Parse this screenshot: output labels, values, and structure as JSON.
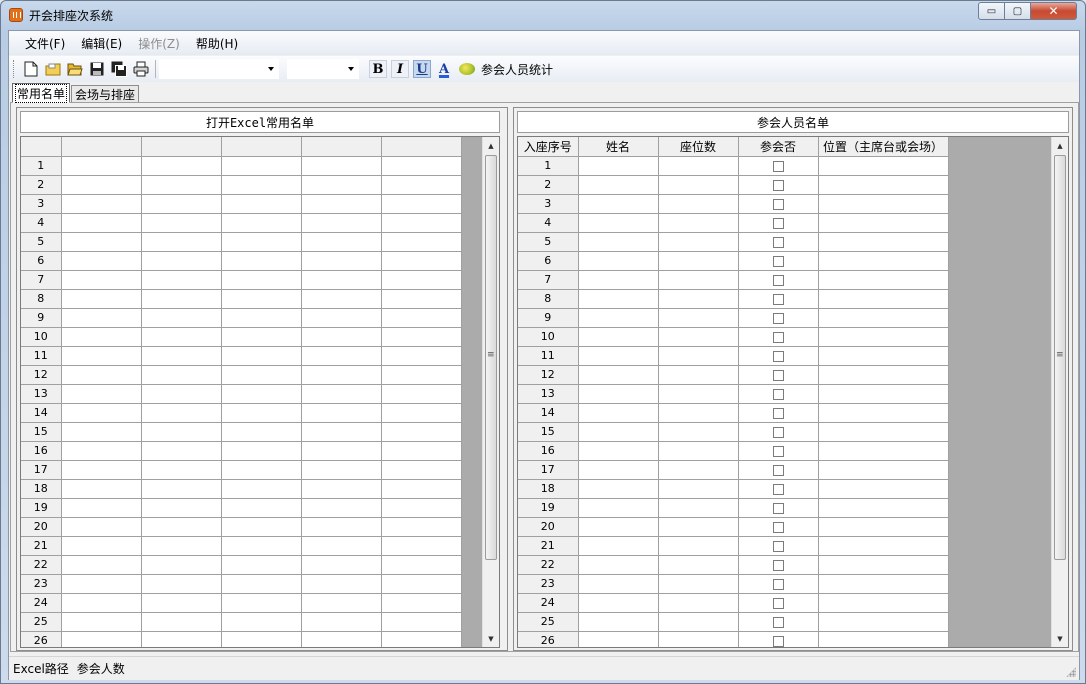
{
  "window": {
    "title": "开会排座次系统",
    "min_label": "▭",
    "max_label": "▢",
    "close_label": "✕"
  },
  "menu": [
    {
      "label": "文件(F)",
      "enabled": true
    },
    {
      "label": "编辑(E)",
      "enabled": true
    },
    {
      "label": "操作(Z)",
      "enabled": false
    },
    {
      "label": "帮助(H)",
      "enabled": true
    }
  ],
  "toolbar": {
    "icons": [
      "new-file-icon",
      "open-file-icon",
      "open-folder-icon",
      "save-icon",
      "save-all-icon",
      "print-icon"
    ],
    "font_combo": "",
    "size_combo": "",
    "bold": "B",
    "italic": "I",
    "underline": "U",
    "font_color": "A",
    "stats_label": "参会人员统计"
  },
  "tabs": [
    {
      "label": "常用名单",
      "active": true
    },
    {
      "label": "会场与排座",
      "active": false
    }
  ],
  "left_panel": {
    "title": "打开Excel常用名单",
    "columns": [
      "",
      "",
      "",
      "",
      ""
    ],
    "rows": [
      1,
      2,
      3,
      4,
      5,
      6,
      7,
      8,
      9,
      10,
      11,
      12,
      13,
      14,
      15,
      16,
      17,
      18,
      19,
      20,
      21,
      22,
      23,
      24,
      25,
      26
    ]
  },
  "right_panel": {
    "title": "参会人员名单",
    "columns": [
      "入座序号",
      "姓名",
      "座位数",
      "参会否",
      "位置（主席台或会场）"
    ],
    "rows": [
      1,
      2,
      3,
      4,
      5,
      6,
      7,
      8,
      9,
      10,
      11,
      12,
      13,
      14,
      15,
      16,
      17,
      18,
      19,
      20,
      21,
      22,
      23,
      24,
      25,
      26
    ]
  },
  "statusbar": {
    "excel_path_label": "Excel路径",
    "attendee_count_label": "参会人数"
  },
  "colors": {
    "titlebar": "#c9d9ec",
    "close_button": "#c74a32",
    "grid_empty": "#ababab"
  }
}
